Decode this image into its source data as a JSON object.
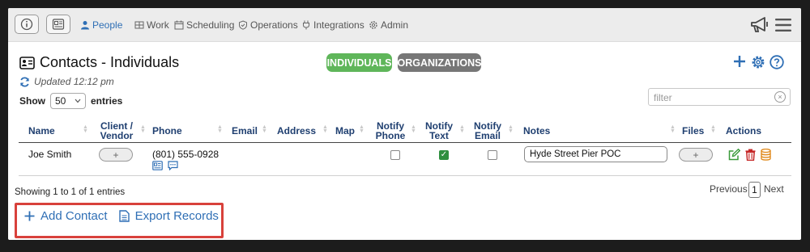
{
  "topbar": {
    "nav": [
      {
        "label": "People",
        "icon": "person-icon",
        "active": true
      },
      {
        "label": "Work",
        "icon": "grid-icon",
        "active": false
      },
      {
        "label": "Scheduling",
        "icon": "calendar-icon",
        "active": false
      },
      {
        "label": "Operations",
        "icon": "shield-icon",
        "active": false
      },
      {
        "label": "Integrations",
        "icon": "plug-icon",
        "active": false
      },
      {
        "label": "Admin",
        "icon": "gear-icon",
        "active": false
      }
    ]
  },
  "page": {
    "title": "Contacts - Individuals",
    "updated": "Updated 12:12 pm",
    "tabs": {
      "individuals": "INDIVIDUALS",
      "organizations": "ORGANIZATIONS"
    },
    "colors": {
      "individuals": "#5fb65a",
      "organizations": "#777777",
      "accent": "#2f6fb5",
      "highlight": "#d8413b"
    }
  },
  "controls": {
    "show_label": "Show",
    "page_size": "50",
    "entries_label": "entries",
    "filter_placeholder": "filter"
  },
  "table": {
    "headers": {
      "name": "Name",
      "client1": "Client /",
      "client2": "Vendor",
      "phone": "Phone",
      "email": "Email",
      "address": "Address",
      "map": "Map",
      "notify_phone1": "Notify",
      "notify_phone2": "Phone",
      "notify_text1": "Notify",
      "notify_text2": "Text",
      "notify_email1": "Notify",
      "notify_email2": "Email",
      "notes": "Notes",
      "files": "Files",
      "actions": "Actions"
    },
    "rows": [
      {
        "name": "Joe Smith",
        "phone": "(801) 555-0928",
        "notify_phone": false,
        "notify_text": true,
        "notify_email": false,
        "notes": "Hyde Street Pier POC"
      }
    ],
    "add_symbol": "+",
    "summary": "Showing 1 to 1 of 1 entries"
  },
  "pagination": {
    "previous": "Previous",
    "current": "1",
    "next": "Next"
  },
  "actions": {
    "add_contact": "Add Contact",
    "export_records": "Export Records"
  }
}
